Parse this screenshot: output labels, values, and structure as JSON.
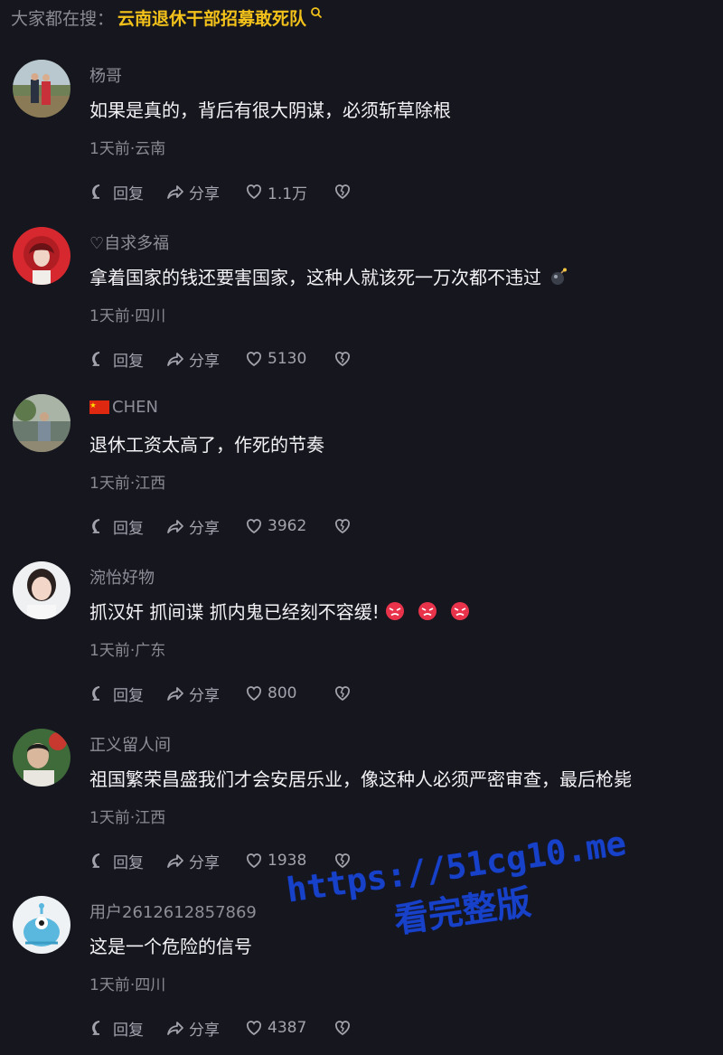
{
  "search": {
    "label": "大家都在搜：",
    "keyword": "云南退休干部招募敢死队"
  },
  "actions": {
    "reply": "回复",
    "share": "分享"
  },
  "comments": [
    {
      "username": "杨哥",
      "text": "如果是真的，背后有很大阴谋，必须斩草除根",
      "meta": "1天前·云南",
      "likes": "1.1万"
    },
    {
      "username": "♡自求多福",
      "text": "拿着国家的钱还要害国家，这种人就该死一万次都不违过",
      "meta": "1天前·四川",
      "likes": "5130",
      "emoji": "bomb"
    },
    {
      "username": "CHEN",
      "text": "退休工资太高了，作死的节奏",
      "meta": "1天前·江西",
      "likes": "3962",
      "flag": "cn-flag"
    },
    {
      "username": "涴怡好物",
      "text": "抓汉奸 抓间谍 抓内鬼已经刻不容缓!",
      "meta": "1天前·广东",
      "likes": "800",
      "emoji": "angry-face x3"
    },
    {
      "username": "正义留人间",
      "text": "祖国繁荣昌盛我们才会安居乐业，像这种人必须严密审查，最后枪毙",
      "meta": "1天前·江西",
      "likes": "1938"
    },
    {
      "username": "用户2612612857869",
      "text": "这是一个危险的信号",
      "meta": "1天前·四川",
      "likes": "4387"
    }
  ],
  "watermark": {
    "line1": "https://51cg10.me",
    "line2": "看完整版"
  },
  "colors": {
    "background": "#16161e",
    "keyword": "#f2c21b",
    "watermark": "#1741c9"
  }
}
